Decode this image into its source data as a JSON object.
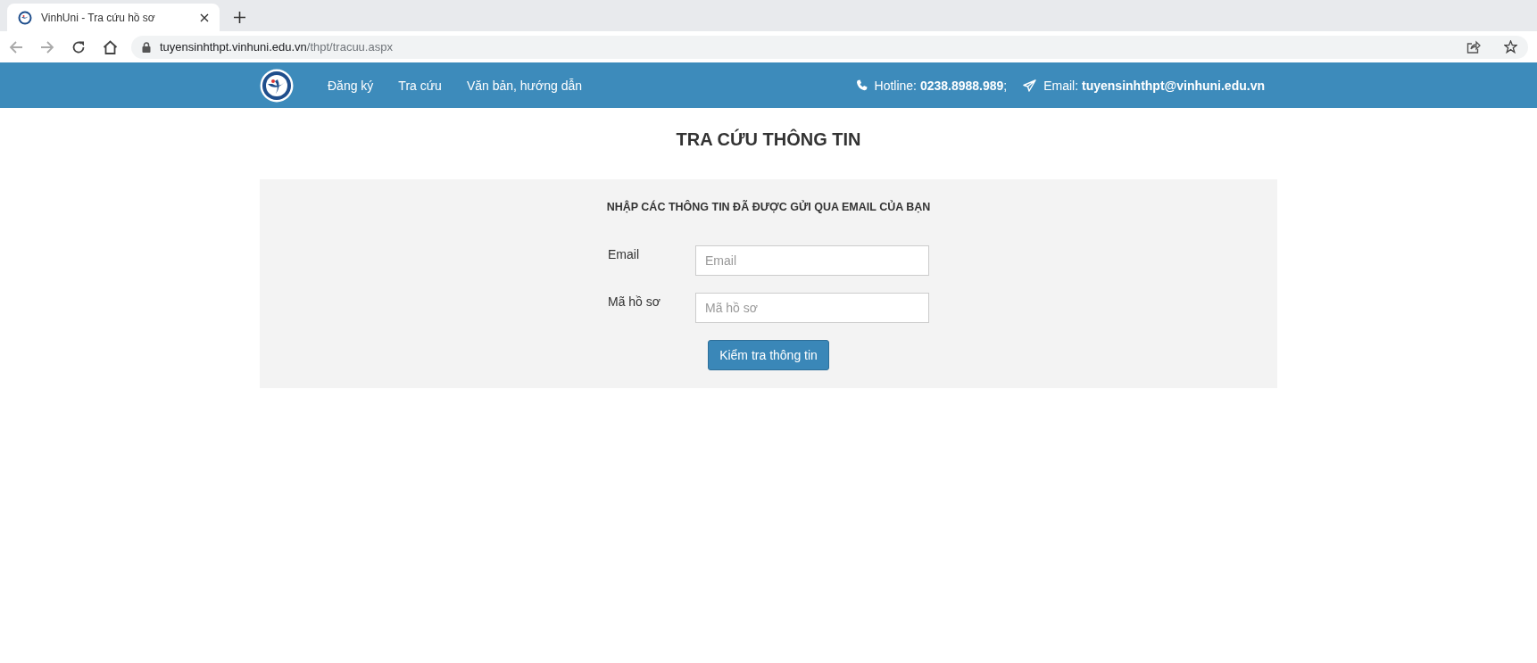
{
  "browser": {
    "tab_title": "VinhUni - Tra cứu hồ sơ",
    "url_host": "tuyensinhthpt.vinhuni.edu.vn",
    "url_path": "/thpt/tracuu.aspx"
  },
  "nav": {
    "links": [
      "Đăng ký",
      "Tra cứu",
      "Văn bản, hướng dẫn"
    ],
    "hotline": "Hotline: **0238.8988.989**;",
    "email": "Email: **tuyensinhthpt@vinhuni.edu.vn**"
  },
  "page_title": "TRA CỨU THÔNG TIN",
  "form": {
    "heading": "NHẬP CÁC THÔNG TIN ĐÃ ĐƯỢC GỬI QUA EMAIL CỦA BẠN",
    "fields": [
      {
        "label": "Email",
        "placeholder": "Email"
      },
      {
        "label": "Mã hồ sơ",
        "placeholder": "Mã hồ sơ"
      }
    ],
    "submit": "Kiểm tra thông tin"
  }
}
